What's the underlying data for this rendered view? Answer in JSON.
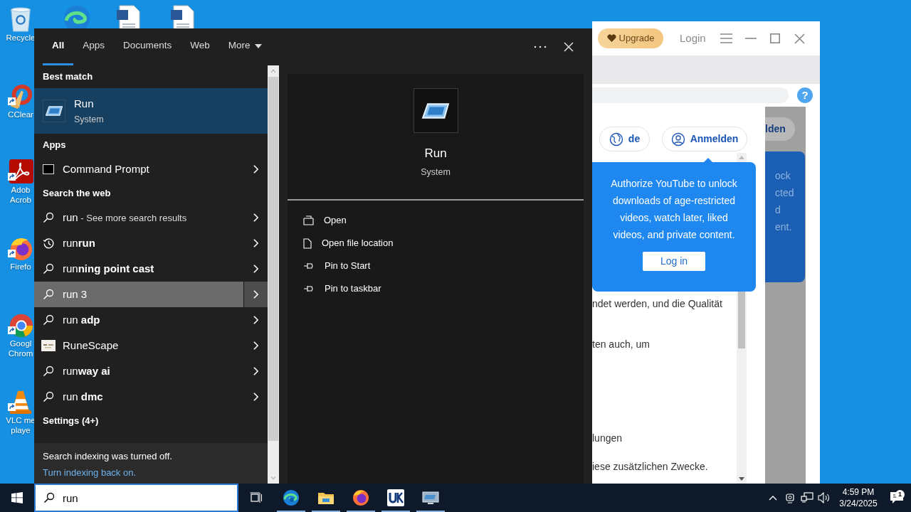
{
  "desktop_icons": [
    {
      "kind": "recycle",
      "label_lines": [
        "Recycle"
      ],
      "shortcut": false
    },
    {
      "kind": "ccleaner",
      "label_lines": [
        "CClear"
      ],
      "shortcut": true
    },
    {
      "kind": "acrobat",
      "label_lines": [
        "Adob",
        "Acrob"
      ],
      "shortcut": true
    },
    {
      "kind": "firefox",
      "label_lines": [
        "Firefo"
      ],
      "shortcut": true
    },
    {
      "kind": "chrome",
      "label_lines": [
        "Googl",
        "Chrom"
      ],
      "shortcut": true
    },
    {
      "kind": "vlc",
      "label_lines": [
        "VLC me",
        "playe"
      ],
      "shortcut": true
    }
  ],
  "desktop_top_icons": [
    {
      "kind": "edge"
    },
    {
      "kind": "document"
    },
    {
      "kind": "document"
    }
  ],
  "background_window": {
    "upgrade": "Upgrade",
    "login": "Login",
    "help": "?",
    "language": "de",
    "sign_in": "Anmelden",
    "sign_in_behind": "lden",
    "behind_text": [
      "ock",
      "cted",
      "d",
      "ent."
    ],
    "popup": {
      "text": "Authorize YouTube to unlock downloads of age-restricted videos, watch later, liked videos, and private content.",
      "button": "Log in"
    },
    "body_lines": [
      "ndet werden, und die Qualität",
      "ten auch, um",
      "lungen",
      "iese zusätzlichen Zwecke."
    ]
  },
  "search_panel": {
    "tabs": [
      {
        "label": "All",
        "selected": true,
        "kind": "tab"
      },
      {
        "label": "Apps",
        "selected": false,
        "kind": "tab"
      },
      {
        "label": "Documents",
        "selected": false,
        "kind": "tab"
      },
      {
        "label": "Web",
        "selected": false,
        "kind": "tab"
      },
      {
        "label": "More",
        "selected": false,
        "kind": "dropdown"
      }
    ],
    "results": [
      {
        "kind": "heading",
        "text": "Best match"
      },
      {
        "kind": "best",
        "title": "Run",
        "subtitle": "System",
        "selected": true,
        "hovered": false
      },
      {
        "kind": "heading",
        "text": "Apps"
      },
      {
        "kind": "app",
        "text": "Command Prompt",
        "selected": false,
        "hovered": false
      },
      {
        "kind": "heading",
        "text": "Search the web"
      },
      {
        "kind": "search",
        "text": "run",
        "hint": " - See more search results",
        "selected": false,
        "hovered": false
      },
      {
        "kind": "history",
        "text": "run**run**",
        "selected": false,
        "hovered": false
      },
      {
        "kind": "search",
        "text": "run**ning point cast**",
        "selected": false,
        "hovered": false
      },
      {
        "kind": "search",
        "text": "run 3",
        "selected": false,
        "hovered": true
      },
      {
        "kind": "search",
        "text": "run **adp**",
        "selected": false,
        "hovered": false
      },
      {
        "kind": "thumbnail",
        "text": "RuneScape",
        "selected": false,
        "hovered": false
      },
      {
        "kind": "search",
        "text": "run**way ai**",
        "selected": false,
        "hovered": false
      },
      {
        "kind": "search",
        "text": "run **dmc**",
        "selected": false,
        "hovered": false
      },
      {
        "kind": "heading",
        "text": "Settings (4+)"
      }
    ],
    "notice": "Search indexing was turned off.",
    "notice_link": "Turn indexing back on.",
    "preview": {
      "title": "Run",
      "subtitle": "System",
      "actions": [
        {
          "kind": "open",
          "label": "Open"
        },
        {
          "kind": "folder",
          "label": "Open file location"
        },
        {
          "kind": "pin",
          "label": "Pin to Start"
        },
        {
          "kind": "pin",
          "label": "Pin to taskbar"
        }
      ]
    }
  },
  "taskbar": {
    "search_value": "run",
    "apps": [
      {
        "kind": "taskview",
        "running": false
      },
      {
        "kind": "edge",
        "running": true
      },
      {
        "kind": "explorer",
        "running": true
      },
      {
        "kind": "firefox",
        "running": true
      },
      {
        "kind": "uk",
        "running": true
      },
      {
        "kind": "runapp",
        "running": true
      }
    ],
    "time": "4:59 PM",
    "date": "3/24/2025",
    "notifications": "1"
  }
}
